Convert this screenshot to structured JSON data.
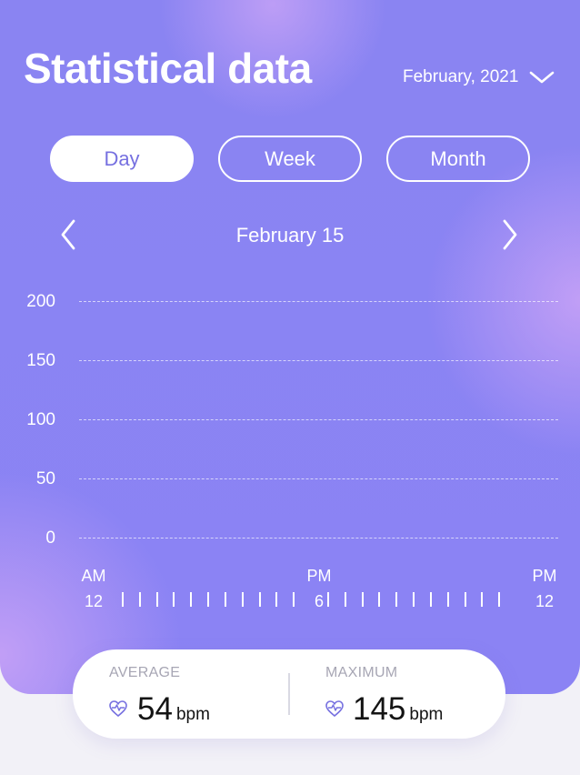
{
  "header": {
    "title": "Statistical data",
    "month_select": "February, 2021"
  },
  "tabs": [
    {
      "label": "Day",
      "active": true
    },
    {
      "label": "Week",
      "active": false
    },
    {
      "label": "Month",
      "active": false
    }
  ],
  "date_nav": {
    "date": "February 15"
  },
  "chart_data": {
    "type": "bar",
    "title": "",
    "y_ticks": [
      "200",
      "150",
      "100",
      "50",
      "0"
    ],
    "ylim": [
      0,
      200
    ],
    "grid": true,
    "x_labels": [
      {
        "top": "AM",
        "bottom": "12"
      },
      {
        "top": "PM",
        "bottom": "6"
      },
      {
        "top": "PM",
        "bottom": "12"
      }
    ],
    "series": []
  },
  "stats": {
    "average": {
      "caption": "AVERAGE",
      "value": "54",
      "unit": "bpm"
    },
    "maximum": {
      "caption": "MAXIMUM",
      "value": "145",
      "unit": "bpm"
    }
  },
  "colors": {
    "background": "#8a84f2",
    "accent": "#7670e0",
    "card": "#ffffff"
  }
}
